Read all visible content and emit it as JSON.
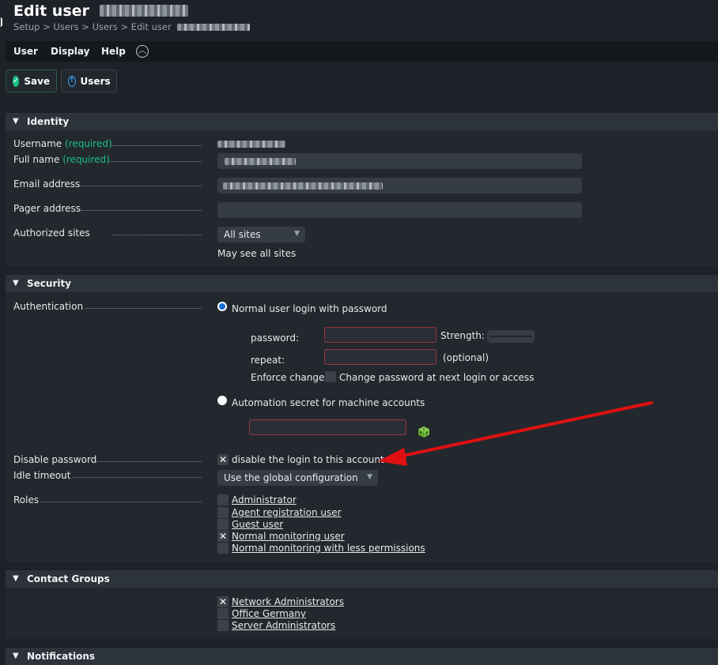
{
  "header": {
    "title": "Edit user",
    "breadcrumb": "Setup > Users > Users > Edit user"
  },
  "menu": {
    "user": "User",
    "display": "Display",
    "help": "Help"
  },
  "toolbar": {
    "save_label": "Save",
    "users_label": "Users"
  },
  "identity": {
    "heading": "Identity",
    "username_label": "Username",
    "full_name_label": "Full name",
    "required": "(required)",
    "email_label": "Email address",
    "pager_label": "Pager address",
    "authorized_sites_label": "Authorized sites",
    "authorized_sites_value": "All sites",
    "authorized_sites_note": "May see all sites"
  },
  "security": {
    "heading": "Security",
    "authentication_label": "Authentication",
    "option_password": "Normal user login with password",
    "password_label": "password:",
    "strength_label": "Strength:",
    "repeat_label": "repeat:",
    "optional": "(optional)",
    "enforce_label": "Enforce change:",
    "enforce_text": "Change password at next login or access",
    "option_automation": "Automation secret for machine accounts",
    "disable_password_label": "Disable password",
    "disable_password_text": "disable the login to this account",
    "idle_timeout_label": "Idle timeout",
    "idle_timeout_value": "Use the global configuration",
    "roles_label": "Roles",
    "roles": [
      {
        "name": "Administrator",
        "checked": false
      },
      {
        "name": "Agent registration user",
        "checked": false
      },
      {
        "name": "Guest user",
        "checked": false
      },
      {
        "name": "Normal monitoring user",
        "checked": true
      },
      {
        "name": "Normal monitoring with less permissions",
        "checked": false
      }
    ]
  },
  "contact_groups": {
    "heading": "Contact Groups",
    "groups": [
      {
        "name": "Network Administrators",
        "checked": true
      },
      {
        "name": "Office Germany",
        "checked": false
      },
      {
        "name": "Server Administrators",
        "checked": false
      }
    ]
  },
  "notifications": {
    "heading": "Notifications"
  },
  "colors": {
    "accent_green": "#19c284",
    "radio_blue": "#1a6dd6",
    "annotation_arrow": "#e01010"
  }
}
